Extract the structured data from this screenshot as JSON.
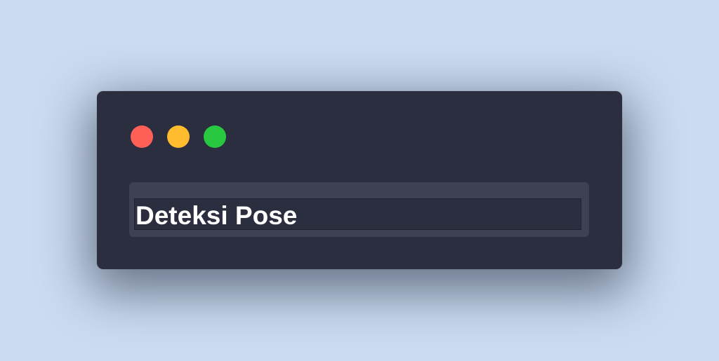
{
  "window": {
    "title": "Deteksi Pose",
    "controls": [
      {
        "name": "close",
        "color": "#fe5f57"
      },
      {
        "name": "minimize",
        "color": "#febc2e"
      },
      {
        "name": "zoom",
        "color": "#28c840"
      }
    ]
  },
  "colors": {
    "background": "#cbdbf1",
    "window_bg": "#2a2e3e",
    "title_box_bg": "#3d4153",
    "text": "#ffffff"
  }
}
